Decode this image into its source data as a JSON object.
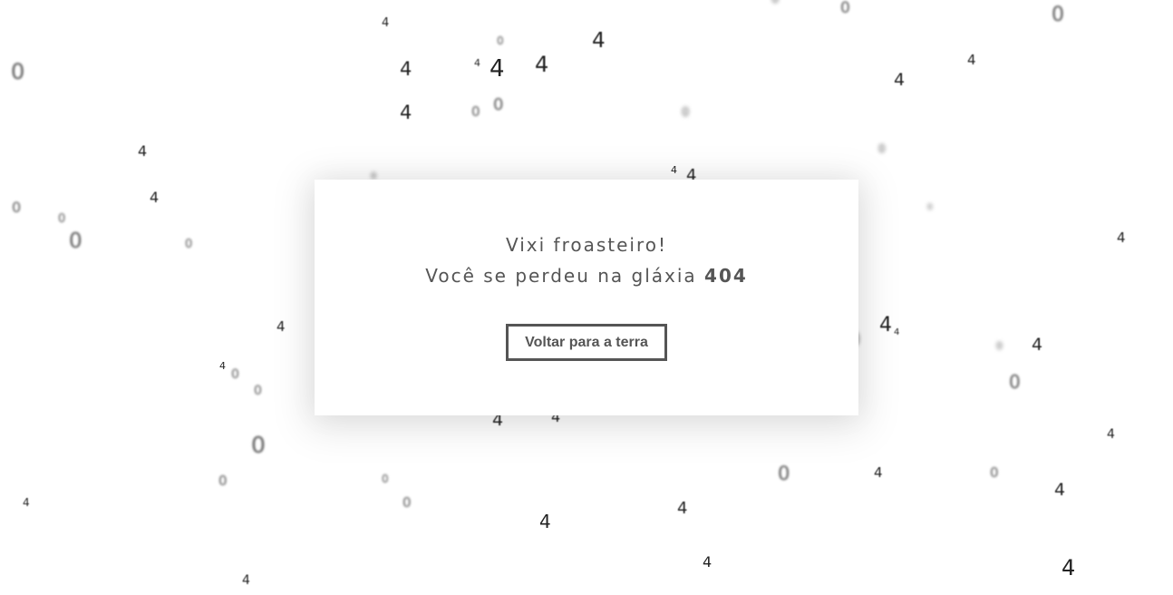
{
  "message": {
    "line1": "Vixi froasteiro!",
    "line2_prefix": "Você se perdeu na gláxia ",
    "line2_code": "404"
  },
  "button": {
    "label": "Voltar para a terra"
  },
  "colors": {
    "text": "#555555",
    "button_border": "#555555",
    "background": "#ffffff",
    "card": "#ffffff"
  },
  "background_glyphs": {
    "zero_char": "0",
    "four_char": "4"
  }
}
